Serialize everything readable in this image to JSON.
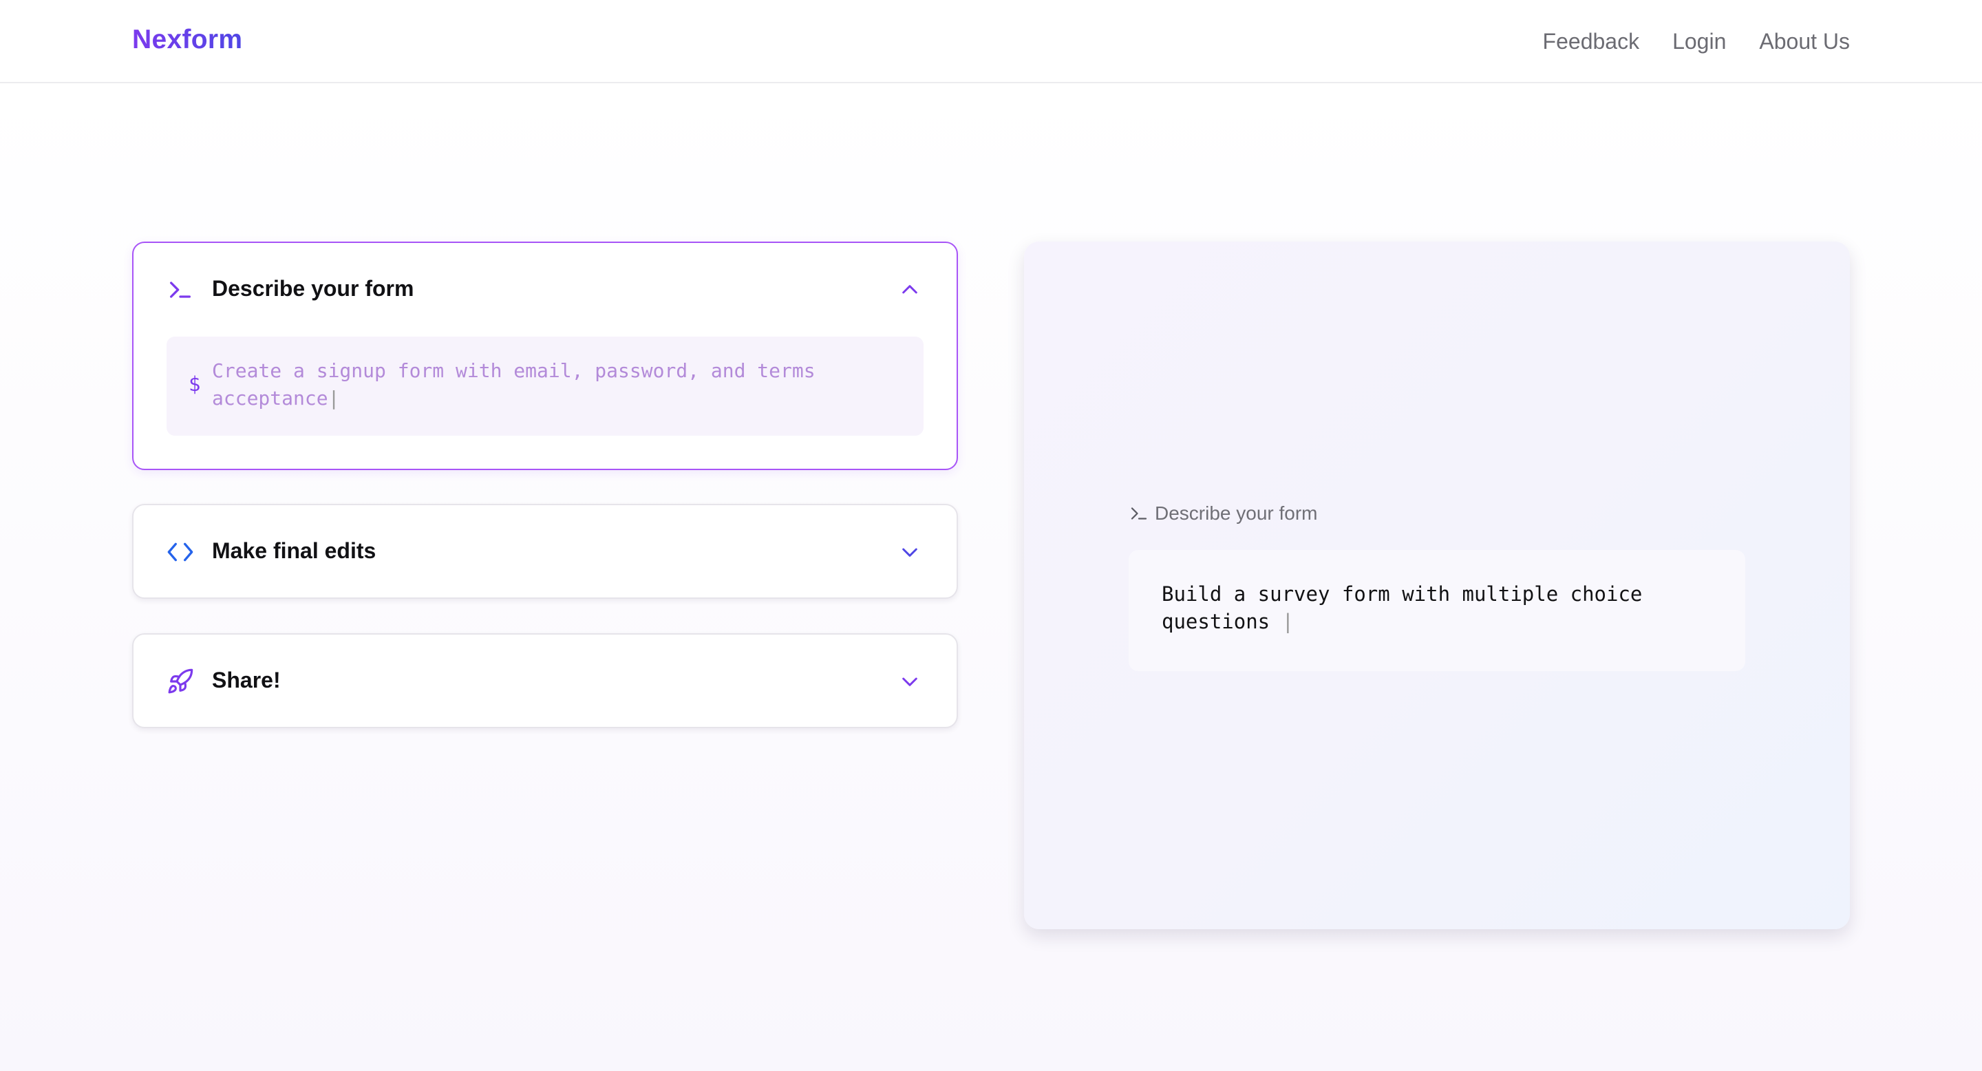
{
  "header": {
    "brand": "Nexform",
    "nav": [
      "Feedback",
      "Login",
      "About Us"
    ]
  },
  "steps": [
    {
      "title": "Describe your form",
      "icon": "terminal-icon",
      "expanded": true,
      "prompt_symbol": "$",
      "prompt_placeholder": "Create a signup form with email, password, and terms acceptance",
      "cursor": "|"
    },
    {
      "title": "Make final edits",
      "icon": "code-icon",
      "expanded": false
    },
    {
      "title": "Share!",
      "icon": "rocket-icon",
      "expanded": false
    }
  ],
  "preview": {
    "label": "Describe your form",
    "icon": "terminal-icon",
    "typed_text": "Build a survey form with multiple choice questions",
    "cursor": "|"
  },
  "colors": {
    "accent_purple": "#7c3aed",
    "accent_blue": "#2563eb",
    "brand_gradient_end": "#4f46e5",
    "active_border": "#a855f7",
    "placeholder_text": "#b38ad9"
  }
}
